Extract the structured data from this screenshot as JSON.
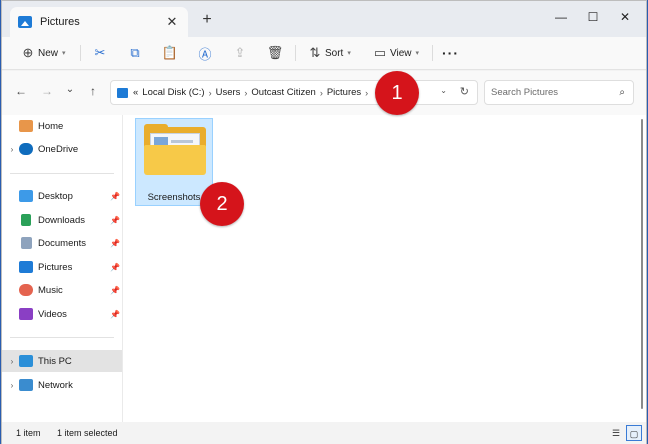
{
  "window": {
    "tab_title": "Pictures",
    "tab_close": "✕",
    "new_tab": "+",
    "minimize": "—",
    "maximize": "☐",
    "close": "✕"
  },
  "toolbar": {
    "new_label": "New",
    "sort_label": "Sort",
    "view_label": "View",
    "more_label": "···",
    "icons": [
      "plus-icon",
      "cut-icon",
      "copy-icon",
      "paste-icon",
      "rename-icon",
      "share-icon",
      "delete-icon",
      "sort-icon",
      "view-icon",
      "more-icon"
    ]
  },
  "address": {
    "overflow": "«",
    "crumbs": [
      "Local Disk (C:)",
      "Users",
      "Outcast Citizen",
      "Pictures"
    ],
    "separator": "›",
    "dropdown": "⌄",
    "refresh": "↻"
  },
  "search": {
    "placeholder": "Search Pictures",
    "icon": "⌕"
  },
  "nav": {
    "back": "←",
    "forward": "→",
    "recent": "⌄",
    "up": "↑",
    "items": [
      {
        "label": "Home"
      },
      {
        "label": "OneDrive",
        "expand": "›"
      },
      {
        "label": "Desktop",
        "pin": "📌"
      },
      {
        "label": "Downloads",
        "pin": "📌"
      },
      {
        "label": "Documents",
        "pin": "📌"
      },
      {
        "label": "Pictures",
        "pin": "📌"
      },
      {
        "label": "Music",
        "pin": "📌"
      },
      {
        "label": "Videos",
        "pin": "📌"
      },
      {
        "label": "This PC",
        "expand": "›"
      },
      {
        "label": "Network",
        "expand": "›"
      }
    ]
  },
  "content": {
    "folder_name": "Screenshots"
  },
  "badges": [
    "1",
    "2"
  ],
  "status": {
    "count": "1 item",
    "selected": "1 item selected"
  },
  "colors": {
    "accent": "#1e7bd6",
    "badge": "#d5141b",
    "selection": "#cce8ff"
  }
}
